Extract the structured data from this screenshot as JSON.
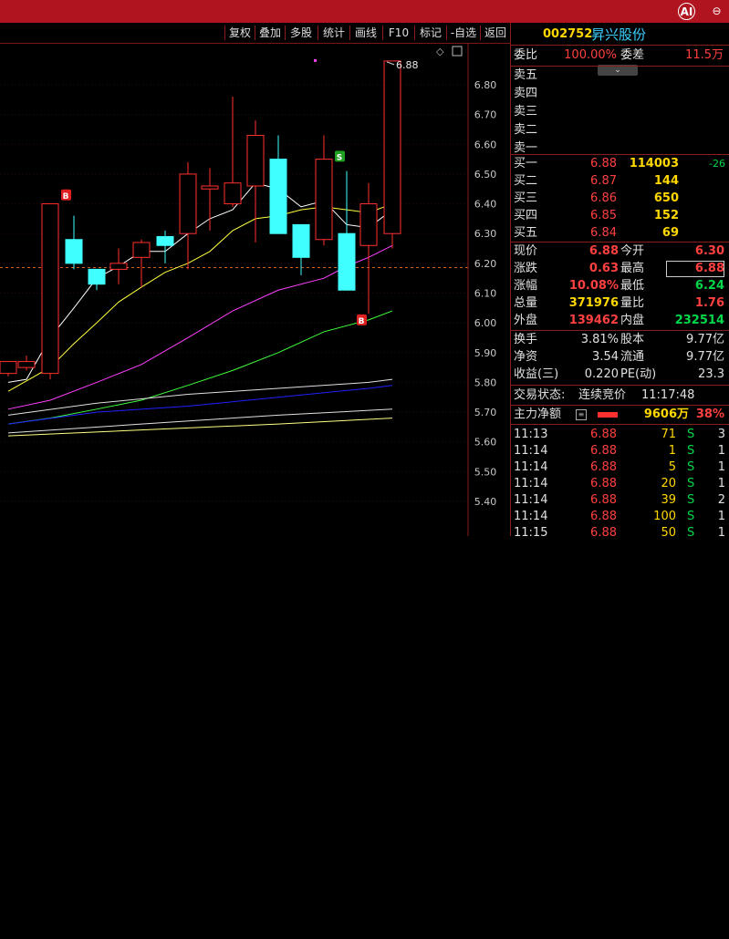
{
  "top_icons": {
    "ai": "AI",
    "minimize": "⊖"
  },
  "toolbar": [
    "复权",
    "叠加",
    "多股",
    "统计",
    "画线",
    "F10",
    "标记",
    "-自选",
    "返回"
  ],
  "chart": {
    "y_ticks": [
      "6.80",
      "6.70",
      "6.60",
      "6.50",
      "6.40",
      "6.30",
      "6.20",
      "6.10",
      "6.00",
      "5.90",
      "5.80",
      "5.70",
      "5.60",
      "5.50",
      "5.40"
    ],
    "ylim": [
      5.4,
      6.8
    ],
    "high_label": "6.88",
    "markers": [
      {
        "text": "B"
      },
      {
        "text": "S"
      },
      {
        "text": "B"
      }
    ],
    "colors": {
      "up": "#ff3030",
      "down": "#40ffff",
      "ma5": "#ffffff",
      "ma10": "#ffff40",
      "ma20": "#ff40ff",
      "ma30": "#40ff40",
      "ma60": "#2020ff"
    }
  },
  "stock": {
    "code": "002752",
    "name": "昇兴股份"
  },
  "weibi": {
    "l1": "委比",
    "v1": "100.00%",
    "l2": "委差",
    "v2": "11.5万"
  },
  "sell": [
    "卖五",
    "卖四",
    "卖三",
    "卖二",
    "卖一"
  ],
  "buy": [
    {
      "label": "买一",
      "price": "6.88",
      "vol": "114003",
      "chg": "-26"
    },
    {
      "label": "买二",
      "price": "6.87",
      "vol": "144",
      "chg": ""
    },
    {
      "label": "买三",
      "price": "6.86",
      "vol": "650",
      "chg": ""
    },
    {
      "label": "买四",
      "price": "6.85",
      "vol": "152",
      "chg": ""
    },
    {
      "label": "买五",
      "price": "6.84",
      "vol": "69",
      "chg": ""
    }
  ],
  "quote": [
    {
      "l1": "现价",
      "v1": "6.88",
      "l2": "今开",
      "v2": "6.30"
    },
    {
      "l1": "涨跌",
      "v1": "0.63",
      "l2": "最高",
      "v2": "6.88"
    },
    {
      "l1": "涨幅",
      "v1": "10.08%",
      "l2": "最低",
      "v2": "6.24"
    },
    {
      "l1": "总量",
      "v1": "371976",
      "l2": "量比",
      "v2": "1.76"
    },
    {
      "l1": "外盘",
      "v1": "139462",
      "l2": "内盘",
      "v2": "232514"
    }
  ],
  "fund": [
    {
      "l1": "换手",
      "v1": "3.81%",
      "l2": "股本",
      "v2": "9.77亿"
    },
    {
      "l1": "净资",
      "v1": "3.54",
      "l2": "流通",
      "v2": "9.77亿"
    },
    {
      "l1": "收益(三)",
      "v1": "0.220",
      "l2": "PE(动)",
      "v2": "23.3"
    }
  ],
  "status": {
    "label": "交易状态:",
    "state": "连续竞价",
    "time": "11:17:48"
  },
  "mainflow": {
    "label": "主力净额",
    "value": "9606万",
    "pct": "38%"
  },
  "ticks": [
    {
      "t": "11:13",
      "p": "6.88",
      "v": "71",
      "d": "S",
      "n": "3"
    },
    {
      "t": "11:14",
      "p": "6.88",
      "v": "1",
      "d": "S",
      "n": "1"
    },
    {
      "t": "11:14",
      "p": "6.88",
      "v": "5",
      "d": "S",
      "n": "1"
    },
    {
      "t": "11:14",
      "p": "6.88",
      "v": "20",
      "d": "S",
      "n": "1"
    },
    {
      "t": "11:14",
      "p": "6.88",
      "v": "39",
      "d": "S",
      "n": "2"
    },
    {
      "t": "11:14",
      "p": "6.88",
      "v": "100",
      "d": "S",
      "n": "1"
    },
    {
      "t": "11:15",
      "p": "6.88",
      "v": "50",
      "d": "S",
      "n": "1"
    }
  ]
}
